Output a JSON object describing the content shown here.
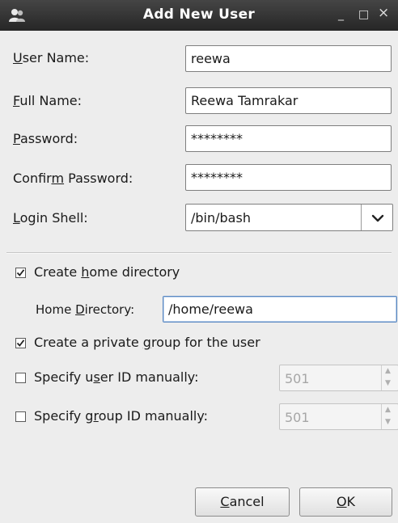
{
  "window": {
    "title": "Add New User",
    "minimize_glyph": "_",
    "maximize_glyph": "□",
    "close_glyph": "×"
  },
  "form": {
    "user_name": {
      "pre": "",
      "mnemonic": "U",
      "post": "ser Name:",
      "value": "reewa"
    },
    "full_name": {
      "pre": "",
      "mnemonic": "F",
      "post": "ull Name:",
      "value": "Reewa Tamrakar"
    },
    "password": {
      "pre": "",
      "mnemonic": "P",
      "post": "assword:",
      "value": "********"
    },
    "confirm_password": {
      "pre": "Confir",
      "mnemonic": "m",
      "post": " Password:",
      "value": "********"
    },
    "login_shell": {
      "pre": "",
      "mnemonic": "L",
      "post": "ogin Shell:",
      "value": "/bin/bash"
    }
  },
  "options": {
    "create_home": {
      "pre": "Create ",
      "mnemonic": "h",
      "post": "ome directory",
      "checked": true
    },
    "home_directory": {
      "pre": "Home ",
      "mnemonic": "D",
      "post": "irectory:",
      "value": "/home/reewa"
    },
    "private_group": {
      "pre": "Create a private ",
      "mnemonic": "g",
      "post": "roup for the user",
      "checked": true
    },
    "user_id": {
      "pre": "Specify u",
      "mnemonic": "s",
      "post": "er ID manually:",
      "checked": false,
      "value": "501"
    },
    "group_id": {
      "pre": "Specify g",
      "mnemonic": "r",
      "post": "oup ID manually:",
      "checked": false,
      "value": "501"
    }
  },
  "buttons": {
    "cancel": {
      "mnemonic": "C",
      "post": "ancel"
    },
    "ok": {
      "mnemonic": "O",
      "post": "K"
    }
  },
  "icons": {
    "app": "users-icon",
    "combo": "chevron-down-icon",
    "check": "checkmark-icon",
    "spin_up": "▲",
    "spin_down": "▼"
  },
  "colors": {
    "titlebar": "#333333",
    "background": "#ededed",
    "focus_border": "#5b89c2"
  }
}
